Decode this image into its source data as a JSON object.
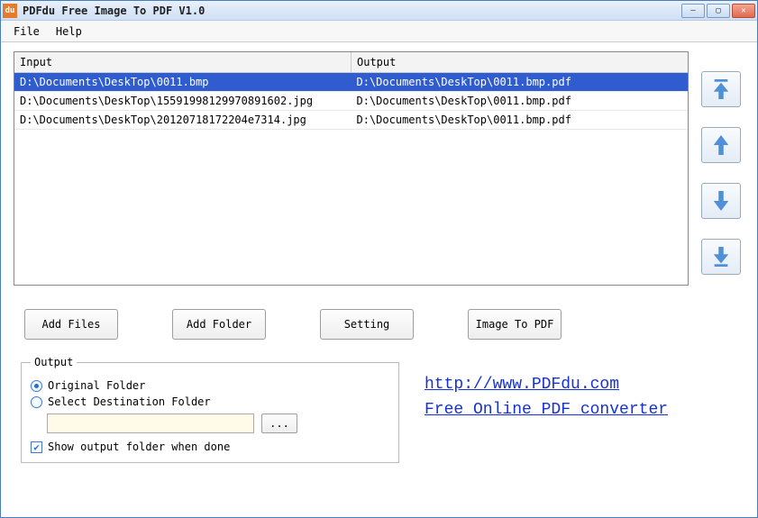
{
  "titlebar": {
    "app_icon_text": "du",
    "title": "PDFdu Free Image To PDF V1.0"
  },
  "menu": {
    "file": "File",
    "help": "Help"
  },
  "table": {
    "col_input": "Input",
    "col_output": "Output",
    "rows": [
      {
        "input": "D:\\Documents\\DeskTop\\0011.bmp",
        "output": "D:\\Documents\\DeskTop\\0011.bmp.pdf",
        "selected": true
      },
      {
        "input": "D:\\Documents\\DeskTop\\15591998129970891602.jpg",
        "output": "D:\\Documents\\DeskTop\\0011.bmp.pdf",
        "selected": false
      },
      {
        "input": "D:\\Documents\\DeskTop\\20120718172204e7314.jpg",
        "output": "D:\\Documents\\DeskTop\\0011.bmp.pdf",
        "selected": false
      }
    ]
  },
  "buttons": {
    "add_files": "Add Files",
    "add_folder": "Add Folder",
    "setting": "Setting",
    "image_to_pdf": "Image To PDF",
    "browse": "..."
  },
  "output": {
    "legend": "Output",
    "radio_original": "Original Folder",
    "radio_select": "Select Destination Folder",
    "original_selected": true,
    "dest_path": "",
    "show_folder_label": "Show output folder when done",
    "show_folder_checked": true
  },
  "links": {
    "site": "http://www.PDFdu.com",
    "tagline": "Free Online PDF converter"
  },
  "colors": {
    "selection": "#2f5dcf",
    "arrow": "#4f90d8"
  }
}
